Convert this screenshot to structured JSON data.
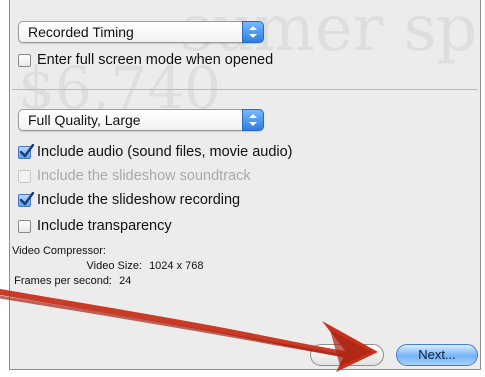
{
  "slideshow": {
    "timing_popup": "Recorded Timing",
    "fullscreen_label": "Enter full screen mode when opened",
    "fullscreen_checked": false
  },
  "export": {
    "quality_popup": "Full Quality, Large",
    "options": [
      {
        "label": "Include audio (sound files, movie audio)",
        "checked": true,
        "enabled": true
      },
      {
        "label": "Include the slideshow soundtrack",
        "checked": false,
        "enabled": false
      },
      {
        "label": "Include the slideshow recording",
        "checked": true,
        "enabled": true
      },
      {
        "label": "Include transparency",
        "checked": false,
        "enabled": true
      }
    ],
    "info": {
      "compressor_label": "Video Compressor:",
      "compressor_value": "",
      "size_label": "Video Size:",
      "size_value": "1024 x 768",
      "fps_label": "Frames per second:",
      "fps_value": "24"
    }
  },
  "buttons": {
    "cancel_label": "",
    "next_label": "Next..."
  },
  "colors": {
    "annotation_arrow": "#c8321c",
    "accent_blue": "#2b7fe4"
  }
}
